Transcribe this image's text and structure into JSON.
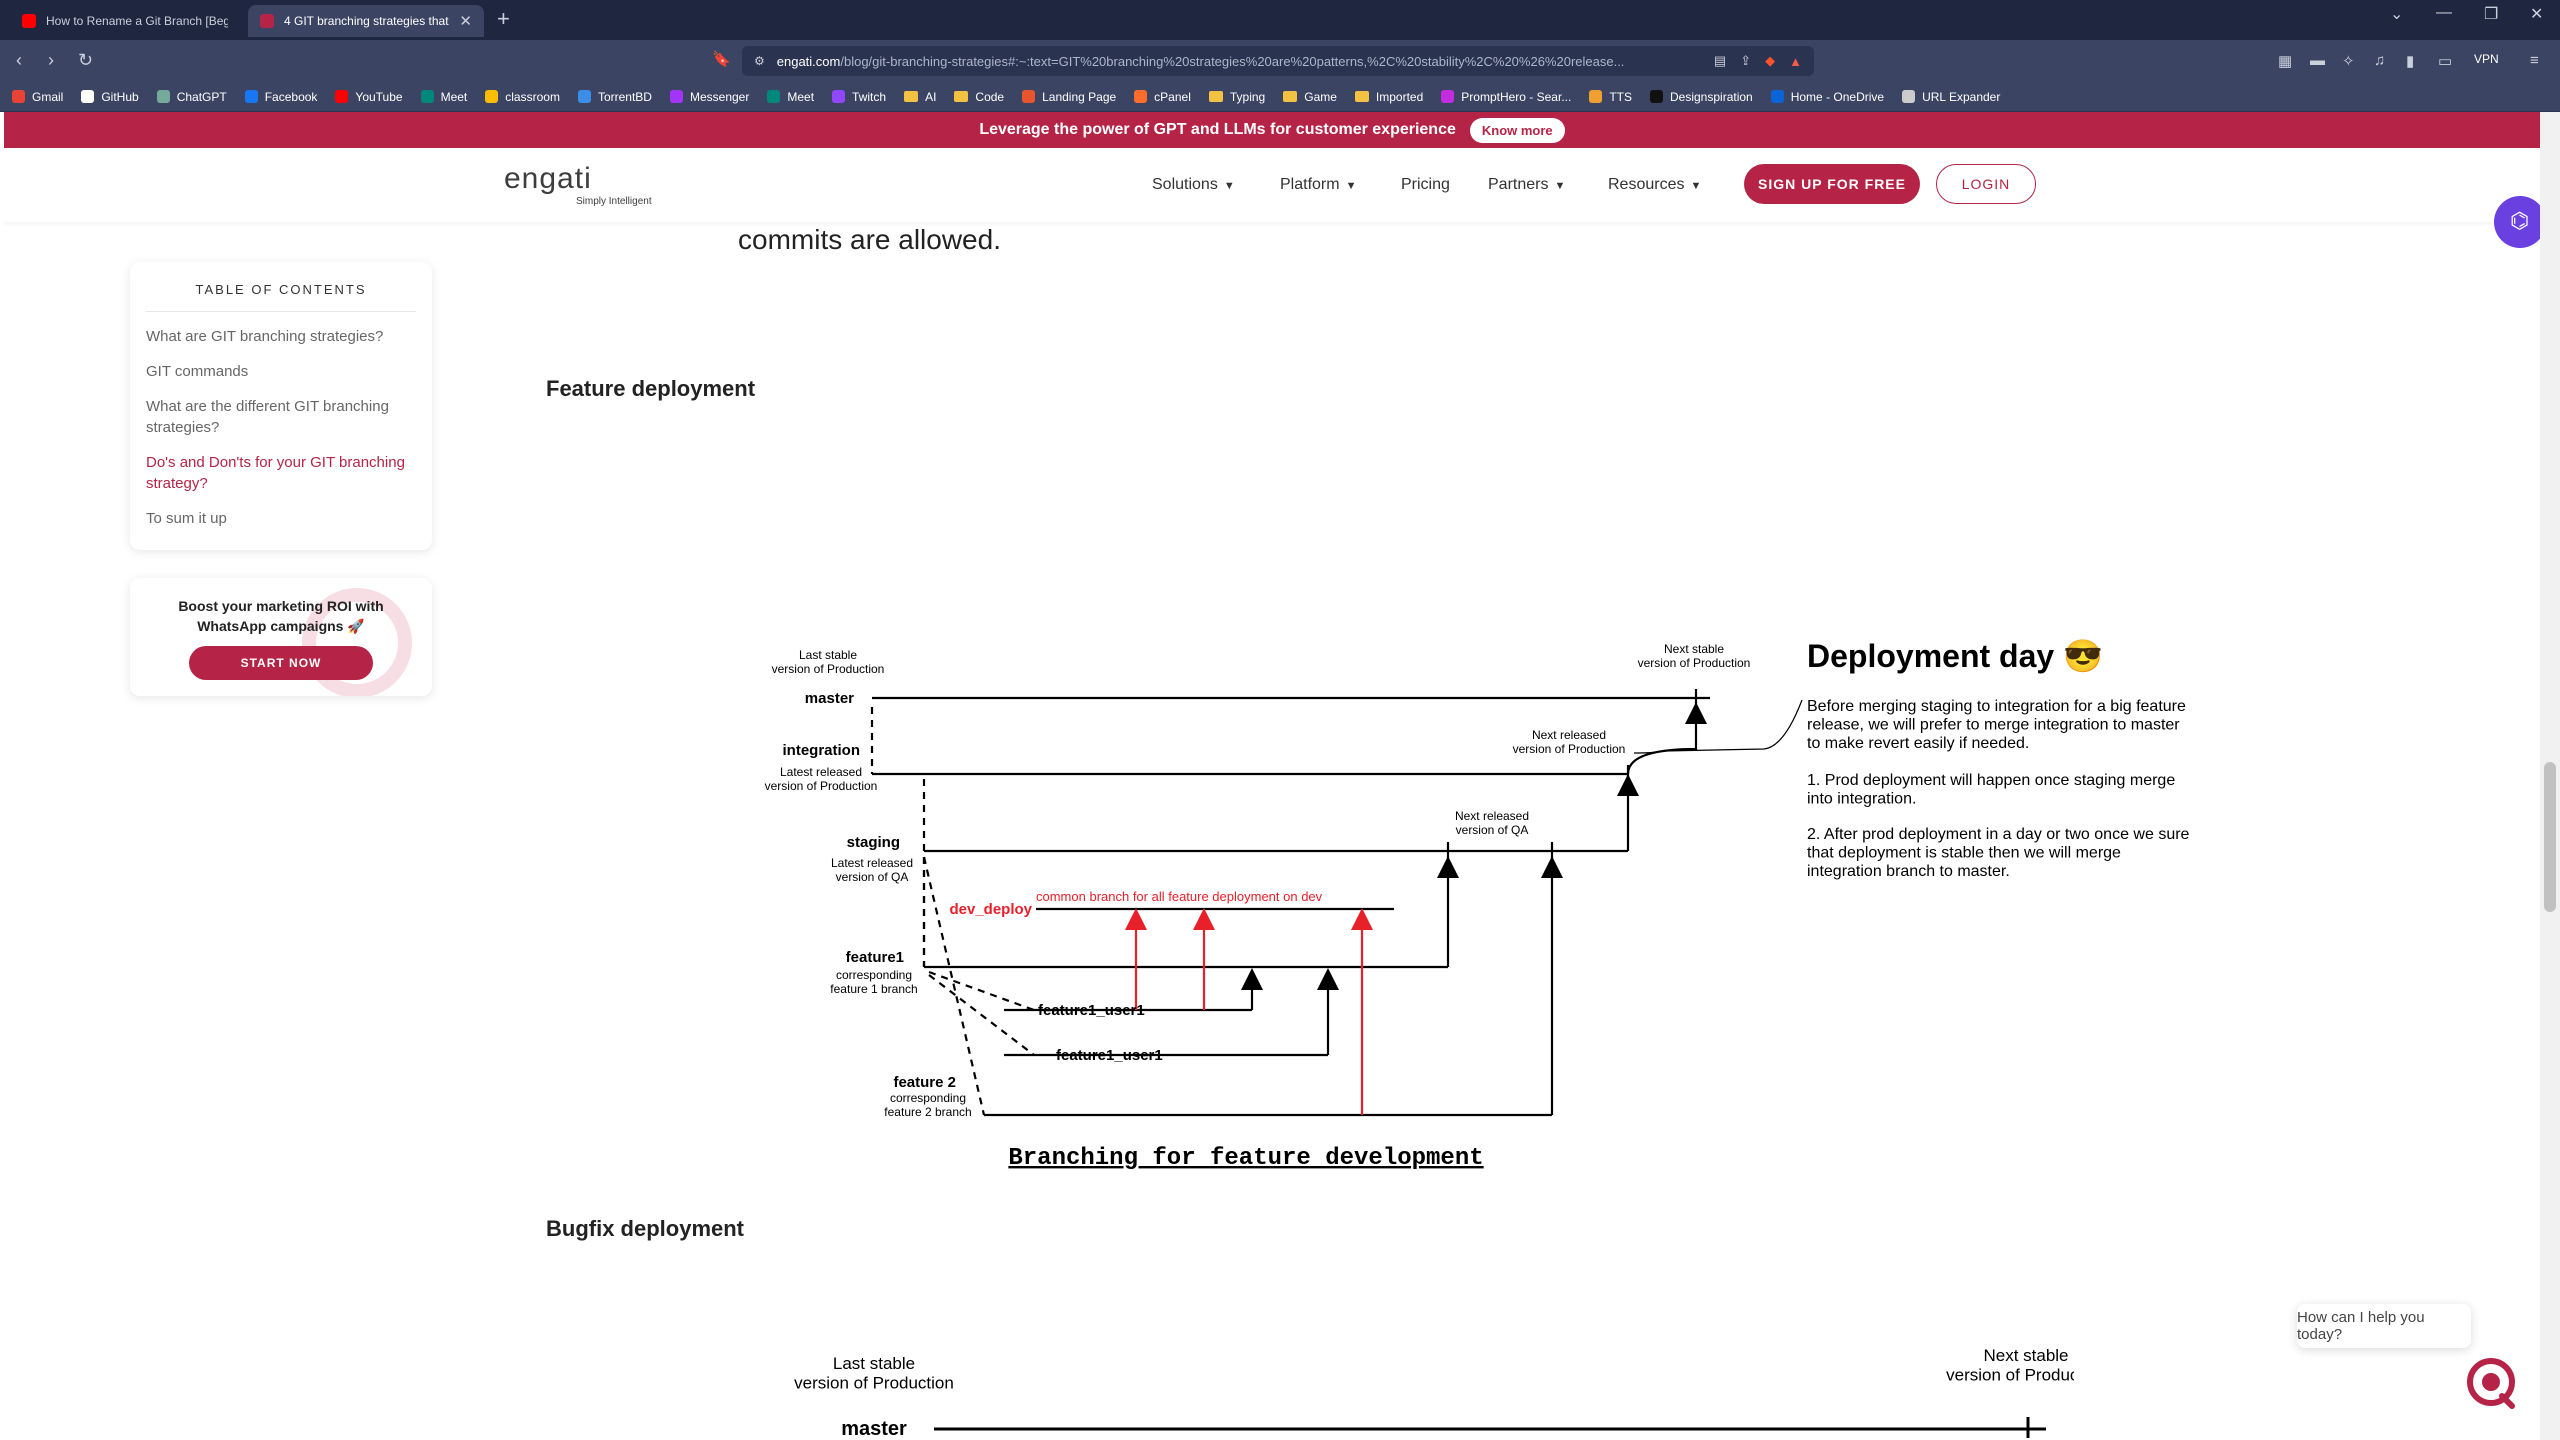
{
  "browser": {
    "tabs": [
      {
        "title": "How to Rename a Git Branch [Beginn",
        "favicon_color": "#ff0000"
      },
      {
        "title": "4 GIT branching strategies that",
        "favicon_color": "#b52446"
      }
    ],
    "url_host": "engati.com",
    "url_path": "/blog/git-branching-strategies#:~:text=GIT%20branching%20strategies%20are%20patterns,%2C%20stability%2C%20%26%20release...",
    "vpn_label": "VPN",
    "bookmarks": [
      {
        "label": "Gmail",
        "color": "#ea4335"
      },
      {
        "label": "GitHub",
        "color": "#ffffff"
      },
      {
        "label": "ChatGPT",
        "color": "#74aa9c"
      },
      {
        "label": "Facebook",
        "color": "#1877f2"
      },
      {
        "label": "YouTube",
        "color": "#ff0000"
      },
      {
        "label": "Meet",
        "color": "#00897b"
      },
      {
        "label": "classroom",
        "color": "#fbbc04"
      },
      {
        "label": "TorrentBD",
        "color": "#3a8ee6"
      },
      {
        "label": "Messenger",
        "color": "#a334fa"
      },
      {
        "label": "Meet",
        "color": "#00897b"
      },
      {
        "label": "Twitch",
        "color": "#9146ff"
      },
      {
        "label": "AI",
        "folder": true
      },
      {
        "label": "Code",
        "folder": true
      },
      {
        "label": "Landing Page",
        "color": "#e8552d"
      },
      {
        "label": "cPanel",
        "color": "#ff6c2c"
      },
      {
        "label": "Typing",
        "folder": true
      },
      {
        "label": "Game",
        "folder": true
      },
      {
        "label": "Imported",
        "folder": true
      },
      {
        "label": "PromptHero - Sear...",
        "color": "#c22de0"
      },
      {
        "label": "TTS",
        "color": "#f0a030"
      },
      {
        "label": "Designspiration",
        "color": "#111111"
      },
      {
        "label": "Home - OneDrive",
        "color": "#0a64d8"
      },
      {
        "label": "URL Expander",
        "color": "#cccccc"
      }
    ]
  },
  "promo": {
    "text": "Leverage the power of GPT and LLMs for customer experience",
    "button": "Know more"
  },
  "site": {
    "logo_word": "engati",
    "logo_tagline": "Simply Intelligent",
    "nav": [
      "Solutions",
      "Platform",
      "Pricing",
      "Partners",
      "Resources"
    ],
    "signup": "SIGN UP FOR FREE",
    "login": "LOGIN"
  },
  "toc": {
    "title": "TABLE OF CONTENTS",
    "items": [
      {
        "label": "What are GIT branching strategies?",
        "active": false
      },
      {
        "label": "GIT commands",
        "active": false
      },
      {
        "label": "What are the different GIT branching strategies?",
        "active": false
      },
      {
        "label": "Do's and Don'ts for your GIT branching strategy?",
        "active": true
      },
      {
        "label": "To sum it up",
        "active": false
      }
    ]
  },
  "roi": {
    "text": "Boost your marketing ROI with WhatsApp campaigns 🚀",
    "button": "START NOW"
  },
  "article": {
    "tail": "commits are allowed.",
    "feature_heading": "Feature deployment",
    "bugfix_heading": "Bugfix deployment"
  },
  "diagram1": {
    "master_label": "master",
    "master_note": "Last stable\nversion of Production",
    "master_next": "Next stable\nversion of Production",
    "integration_label": "integration",
    "integration_note": "Latest released\nversion of Production",
    "integration_next": "Next released\nversion of Production",
    "staging_label": "staging",
    "staging_note": "Latest released\nversion of QA",
    "staging_next": "Next released\nversion of QA",
    "dev_label": "dev_deploy",
    "dev_note": "common branch for all feature deployment on dev",
    "feature1_label": "feature1",
    "feature1_note": "corresponding\nfeature 1 branch",
    "user1a": "feature1_user1",
    "user1b": "feature1_user1",
    "feature2_label": "feature 2",
    "feature2_note": "corresponding\nfeature 2 branch",
    "caption": "Branching for feature development",
    "side_title": "Deployment day 😎",
    "side_p1": "Before merging staging to integration for a big feature\nrelease, we will prefer to merge integration to master\nto make revert easily if needed.",
    "side_p2": "1. Prod deployment will happen once staging merge\ninto integration.",
    "side_p3": "2. After prod deployment in a day or two once we sure\nthat deployment is stable then we will merge\nintegration branch to master."
  },
  "diagram2": {
    "master_note": "Last stable\nversion of Production",
    "master_label": "master",
    "master_next": "Next stable\nversion of Production"
  },
  "chat": {
    "bubble": "How can I help you today?"
  },
  "colors": {
    "brand": "#b52446",
    "assist": "#6a40e0",
    "diagram_red": "#e8202a"
  }
}
